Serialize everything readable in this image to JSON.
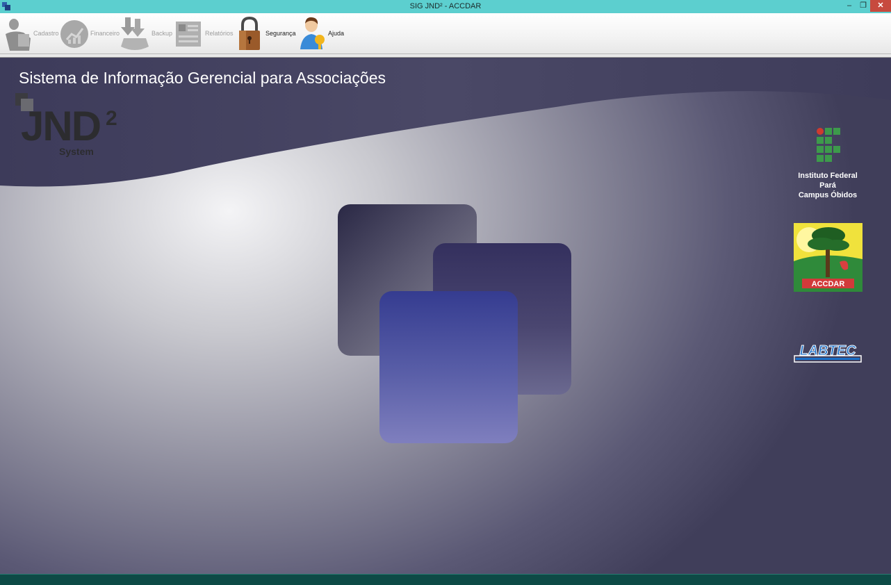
{
  "window": {
    "title": "SIG JND² - ACCDAR",
    "minimize_label": "‒",
    "maximize_label": "❐",
    "close_label": "✕"
  },
  "toolbar": {
    "items": [
      {
        "label": "Cadastro",
        "icon": "cadastro-icon",
        "enabled": false
      },
      {
        "label": "Financeiro",
        "icon": "chart-icon",
        "enabled": false
      },
      {
        "label": "Backup",
        "icon": "backup-icon",
        "enabled": false
      },
      {
        "label": "Relatórios",
        "icon": "report-icon",
        "enabled": false
      },
      {
        "label": "Segurança",
        "icon": "padlock-icon",
        "enabled": true
      },
      {
        "label": "Ajuda",
        "icon": "help-user-icon",
        "enabled": true
      }
    ]
  },
  "main": {
    "subtitle": "Sistema de Informação Gerencial para Associações",
    "jnd_logo": {
      "text": "JND",
      "superscript": "2",
      "tagline": "System"
    },
    "if_logo": {
      "line1": "Instituto Federal",
      "line2": "Pará",
      "line3": "Campus Óbidos"
    },
    "accdar_logo": {
      "text": "ACCDAR"
    },
    "labtec_logo": {
      "text": "LABTEC"
    }
  },
  "colors": {
    "titlebar": "#5ccfcf",
    "close_button": "#c74a3e",
    "statusbar": "#0d4a46",
    "tile_front": "#3a3f95",
    "if_green": "#3d9a4b",
    "if_red": "#d03a2e"
  }
}
